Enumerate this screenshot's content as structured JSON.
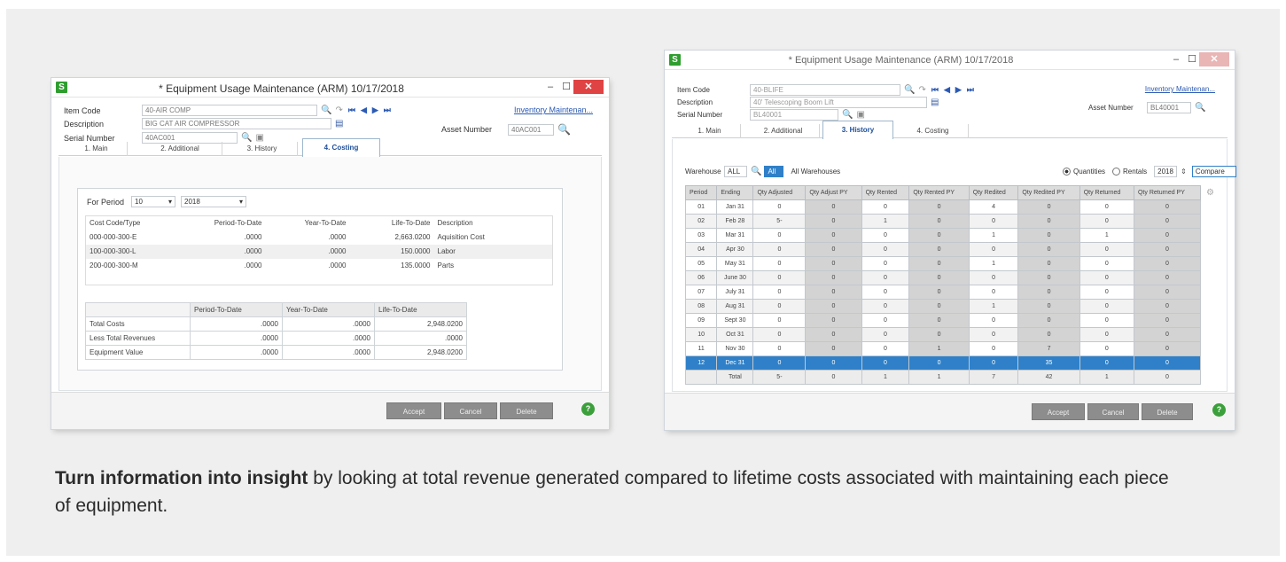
{
  "caption": {
    "bold": "Turn information into insight",
    "rest": " by looking at total revenue generated compared to lifetime costs associated with maintaining each piece of equipment."
  },
  "colors": {
    "accent": "#2c5ab4",
    "selected_row": "#2f80c8",
    "close": "#e04343",
    "help": "#3ba03b"
  },
  "win1": {
    "app_icon": "S",
    "title": "* Equipment Usage Maintenance (ARM) 10/17/2018",
    "controls": {
      "min": "–",
      "max": "☐",
      "close": "✕"
    },
    "header": {
      "item_code_label": "Item Code",
      "item_code_value": "40-AIR COMP",
      "description_label": "Description",
      "description_value": "BIG CAT AIR COMPRESSOR",
      "serial_label": "Serial Number",
      "serial_value": "40AC001",
      "asset_label": "Asset Number",
      "asset_value": "40AC001",
      "inventory_link": "Inventory Maintenan..."
    },
    "tabs": [
      "1. Main",
      "2. Additional",
      "3. History",
      "4. Costing"
    ],
    "period_label": "For Period",
    "period_value": "10",
    "year_value": "2018",
    "cost_headers": [
      "Cost Code/Type",
      "Period-To-Date",
      "Year-To-Date",
      "Life-To-Date",
      "Description"
    ],
    "cost_rows": [
      [
        "000-000-300-E",
        ".0000",
        ".0000",
        "2,663.0200",
        "Aquisition Cost"
      ],
      [
        "100-000-300-L",
        ".0000",
        ".0000",
        "150.0000",
        "Labor"
      ],
      [
        "200-000-300-M",
        ".0000",
        ".0000",
        "135.0000",
        "Parts"
      ]
    ],
    "sum_headers": [
      "",
      "Period-To-Date",
      "Year-To-Date",
      "Life-To-Date"
    ],
    "sum_rows": [
      [
        "Total Costs",
        ".0000",
        ".0000",
        "2,948.0200"
      ],
      [
        "Less Total Revenues",
        ".0000",
        ".0000",
        ".0000"
      ],
      [
        "Equipment Value",
        ".0000",
        ".0000",
        "2,948.0200"
      ]
    ],
    "buttons": {
      "accept": "Accept",
      "cancel": "Cancel",
      "delete": "Delete",
      "help": "?"
    }
  },
  "win2": {
    "app_icon": "S",
    "title": "* Equipment Usage Maintenance (ARM) 10/17/2018",
    "controls": {
      "min": "–",
      "max": "☐",
      "close": "✕"
    },
    "header": {
      "item_code_label": "Item Code",
      "item_code_value": "40-BLIFE",
      "description_label": "Description",
      "description_value": "40' Telescoping Boom Lift",
      "serial_label": "Serial Number",
      "serial_value": "BL40001",
      "asset_label": "Asset Number",
      "asset_value": "BL40001",
      "inventory_link": "Inventory Maintenan..."
    },
    "tabs": [
      "1. Main",
      "2. Additional",
      "3. History",
      "4. Costing"
    ],
    "warehouse_label": "Warehouse",
    "warehouse_value": "ALL",
    "warehouse_all_btn": "All",
    "warehouse_desc": "All Warehouses",
    "radio_quantities": "Quantities",
    "radio_rentals": "Rentals",
    "year_value": "2018",
    "compare_label": "Compare",
    "hist_headers": [
      "Period",
      "Ending",
      "Qty Adjusted",
      "Qty Adjust PY",
      "Qty Rented",
      "Qty Rented PY",
      "Qty Redited",
      "Qty Redited PY",
      "Qty Returned",
      "Qty Returned PY"
    ],
    "hist_rows": [
      [
        "01",
        "Jan 31",
        "0",
        "0",
        "0",
        "0",
        "4",
        "0",
        "0",
        "0"
      ],
      [
        "02",
        "Feb 28",
        "5-",
        "0",
        "1",
        "0",
        "0",
        "0",
        "0",
        "0"
      ],
      [
        "03",
        "Mar 31",
        "0",
        "0",
        "0",
        "0",
        "1",
        "0",
        "1",
        "0"
      ],
      [
        "04",
        "Apr 30",
        "0",
        "0",
        "0",
        "0",
        "0",
        "0",
        "0",
        "0"
      ],
      [
        "05",
        "May 31",
        "0",
        "0",
        "0",
        "0",
        "1",
        "0",
        "0",
        "0"
      ],
      [
        "06",
        "June 30",
        "0",
        "0",
        "0",
        "0",
        "0",
        "0",
        "0",
        "0"
      ],
      [
        "07",
        "July 31",
        "0",
        "0",
        "0",
        "0",
        "0",
        "0",
        "0",
        "0"
      ],
      [
        "08",
        "Aug 31",
        "0",
        "0",
        "0",
        "0",
        "1",
        "0",
        "0",
        "0"
      ],
      [
        "09",
        "Sept 30",
        "0",
        "0",
        "0",
        "0",
        "0",
        "0",
        "0",
        "0"
      ],
      [
        "10",
        "Oct 31",
        "0",
        "0",
        "0",
        "0",
        "0",
        "0",
        "0",
        "0"
      ],
      [
        "11",
        "Nov 30",
        "0",
        "0",
        "0",
        "1",
        "0",
        "7",
        "0",
        "0"
      ],
      [
        "12",
        "Dec 31",
        "0",
        "0",
        "0",
        "0",
        "0",
        "35",
        "0",
        "0"
      ]
    ],
    "hist_total": [
      "",
      "Total",
      "5-",
      "0",
      "1",
      "1",
      "7",
      "42",
      "1",
      "0"
    ],
    "buttons": {
      "accept": "Accept",
      "cancel": "Cancel",
      "delete": "Delete",
      "help": "?"
    }
  }
}
